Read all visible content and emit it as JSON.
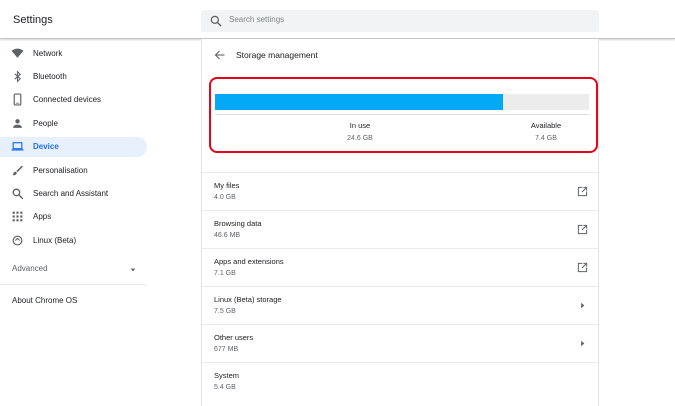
{
  "app": {
    "title": "Settings"
  },
  "search": {
    "placeholder": "Search settings"
  },
  "sidebar": {
    "items": [
      {
        "label": "Network",
        "icon": "wifi-icon",
        "active": false
      },
      {
        "label": "Bluetooth",
        "icon": "bluetooth-icon",
        "active": false
      },
      {
        "label": "Connected devices",
        "icon": "phone-icon",
        "active": false
      },
      {
        "label": "People",
        "icon": "person-icon",
        "active": false
      },
      {
        "label": "Device",
        "icon": "laptop-icon",
        "active": true
      },
      {
        "label": "Personalisation",
        "icon": "brush-icon",
        "active": false
      },
      {
        "label": "Search and Assistant",
        "icon": "search-icon",
        "active": false
      },
      {
        "label": "Apps",
        "icon": "apps-grid-icon",
        "active": false
      },
      {
        "label": "Linux (Beta)",
        "icon": "linux-icon",
        "active": false
      }
    ],
    "advanced_label": "Advanced",
    "about_label": "About Chrome OS"
  },
  "page": {
    "title": "Storage management"
  },
  "usage": {
    "in_use_label": "In use",
    "in_use_value": "24.6 GB",
    "available_label": "Available",
    "available_value": "7.4 GB",
    "fill_fraction": 0.77,
    "fill_color": "#03a9f4",
    "highlight_color": "#e2061a"
  },
  "rows": [
    {
      "name": "My files",
      "size": "4.0 GB",
      "action": "open-external-icon"
    },
    {
      "name": "Browsing data",
      "size": "46.6 MB",
      "action": "open-external-icon"
    },
    {
      "name": "Apps and extensions",
      "size": "7.1 GB",
      "action": "open-external-icon"
    },
    {
      "name": "Linux (Beta) storage",
      "size": "7.5 GB",
      "action": "chevron-right-icon"
    },
    {
      "name": "Other users",
      "size": "677 MB",
      "action": "chevron-right-icon"
    },
    {
      "name": "System",
      "size": "5.4 GB",
      "action": ""
    }
  ]
}
